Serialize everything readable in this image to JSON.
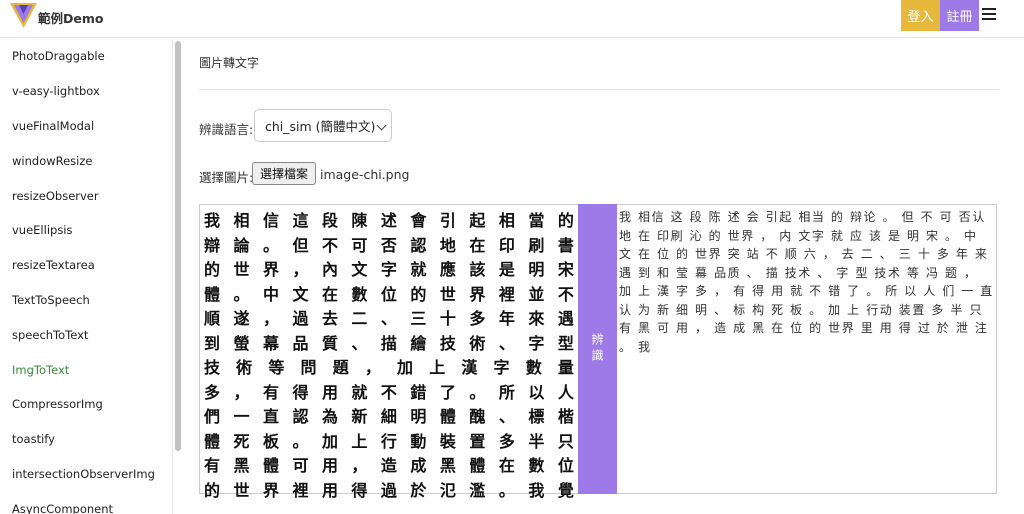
{
  "header": {
    "brand": "範例Demo",
    "login_label": "登入",
    "register_label": "註冊",
    "menu_icon": "hamburger-icon",
    "colors": {
      "login": "#e6b83c",
      "register": "#9d7ae8"
    }
  },
  "sidebar": {
    "items": [
      {
        "label": "PhotoDraggable",
        "active": false
      },
      {
        "label": "v-easy-lightbox",
        "active": false
      },
      {
        "label": "vueFinalModal",
        "active": false
      },
      {
        "label": "windowResize",
        "active": false
      },
      {
        "label": "resizeObserver",
        "active": false
      },
      {
        "label": "vueEllipsis",
        "active": false
      },
      {
        "label": "resizeTextarea",
        "active": false
      },
      {
        "label": "TextToSpeech",
        "active": false
      },
      {
        "label": "speechToText",
        "active": false
      },
      {
        "label": "ImgToText",
        "active": true
      },
      {
        "label": "CompressorImg",
        "active": false
      },
      {
        "label": "toastify",
        "active": false
      },
      {
        "label": "intersectionObserverImg",
        "active": false
      },
      {
        "label": "AsyncComponent",
        "active": false
      }
    ],
    "active_color": "#3a8a3a"
  },
  "main": {
    "title": "圖片轉文字",
    "language_label": "辨識語言:",
    "language_selected": "chi_sim (簡體中文)",
    "file_label": "選擇圖片:",
    "file_button": "選擇檔案",
    "file_name": "image-chi.png",
    "recognize_label": "辨識",
    "image_lines": [
      "我相信這段陳述會引起相當的",
      "辯論。但不可否認地在印刷書",
      "的世界，內文字就應該是明宋",
      "體。中文在數位的世界裡並不",
      "順遂，過去二、三十多年來遇",
      "到螢幕品質、描繪技術、字型",
      "技術等問題，加上漢字數量",
      "多，有得用就不錯了。所以人",
      "們一直認為新細明體醜、標楷",
      "體死板。加上行動裝置多半只",
      "有黑體可用，造成黑體在數位",
      "的世界裡用得過於氾濫。我覺"
    ],
    "result_text": "我 相信 这 段 陈 述 会 引起 相当 的 辩论 。 但 不 可 否认 地 在 印刷 沁 的 世界 ， 内 文字 就 应 该 是 明 宋 。 中 文 在 位 的 世界 突 站 不 顺 六 ， 去 二 、 三 十 多 年 来 遇 到 和 莹 幕 品质 、 描 技术 、 字 型 技术 等 冯 题 ， 加 上 漢 字 多 ， 有 得 用 就 不 错 了 。 所 以 人 们 一 直 认 为 新 细 明 、 标 构 死 板 。 加 上 行动 装置 多 半 只 有 黑 可 用 ， 造 成 黑 在 位 的 世界 里 用 得 过 於 泄 注 。 我"
  }
}
